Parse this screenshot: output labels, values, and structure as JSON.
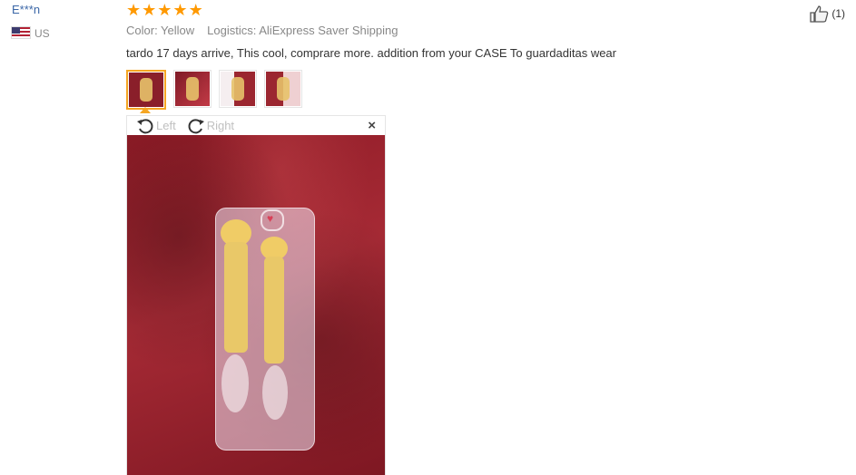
{
  "review": {
    "user": "E***n",
    "country": "US",
    "rating_count": 5,
    "stars": [
      "★",
      "★",
      "★",
      "★",
      "★"
    ],
    "color_label": "Color: Yellow",
    "logistics_label": "Logistics: AliExpress Saver Shipping",
    "text": "tardo 17 days arrive, This cool, comprare more. addition from your CASE To guardaditas wear",
    "likes": "(1)"
  },
  "viewer": {
    "rotate_left": "Left",
    "rotate_right": "Right",
    "close": "×"
  },
  "colors": {
    "accent": "#ff9900",
    "link": "#3a66a7",
    "active_thumb": "#f5a623"
  }
}
